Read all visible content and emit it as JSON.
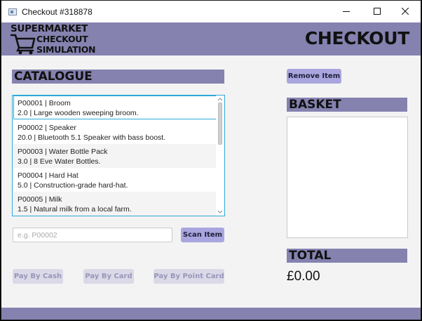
{
  "window": {
    "title": "Checkout #318878"
  },
  "header": {
    "logo": {
      "line1": "SUPERMARKET",
      "line2": "CHECKOUT",
      "line3": "SIMULATION"
    },
    "title": "CHECKOUT"
  },
  "catalogue": {
    "heading": "CATALOGUE",
    "items": [
      {
        "line1": "P00001 | Broom",
        "line2": "2.0 | Large wooden sweeping broom."
      },
      {
        "line1": "P00002 | Speaker",
        "line2": "20.0 | Bluetooth 5.1 Speaker with bass boost."
      },
      {
        "line1": "P00003 | Water Bottle Pack",
        "line2": "3.0 | 8 Eve Water Bottles."
      },
      {
        "line1": "P00004 | Hard Hat",
        "line2": "5.0 | Construction-grade hard-hat."
      },
      {
        "line1": "P00005 | Milk",
        "line2": "1.5 | Natural milk from a local farm."
      }
    ]
  },
  "scan": {
    "placeholder": "e.g. P00002",
    "button": "Scan Item"
  },
  "payment": {
    "cash": "Pay By Cash",
    "card": "Pay By Card",
    "point_card": "Pay By Point Card"
  },
  "basket": {
    "remove_button": "Remove Item",
    "heading": "BASKET",
    "items": []
  },
  "total": {
    "heading": "TOTAL",
    "amount": "£0.00"
  },
  "colors": {
    "accent": "#8582b0",
    "button": "#a9a6df",
    "button_disabled": "#dad9e8",
    "selection": "#2aa8d8"
  }
}
